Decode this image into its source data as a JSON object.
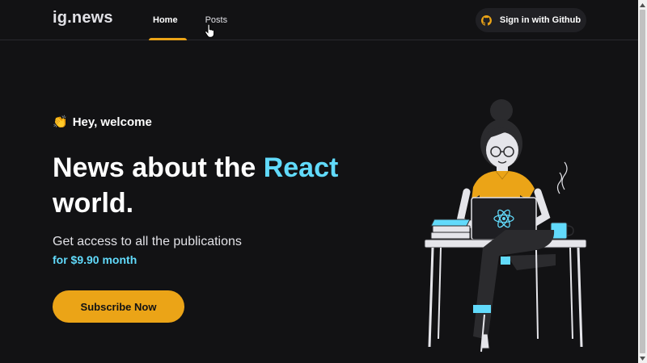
{
  "header": {
    "logo": "ig.news",
    "nav": [
      {
        "label": "Home",
        "active": true
      },
      {
        "label": "Posts",
        "active": false
      }
    ],
    "signin_label": "Sign in with Github"
  },
  "hero": {
    "greeting_icon": "clapping-hands-icon",
    "greeting": "Hey, welcome",
    "headline_part1": "News about the ",
    "headline_accent": "React",
    "headline_part2": "world.",
    "subtext": "Get access to all the publications",
    "price": "for $9.90 month",
    "cta_label": "Subscribe Now"
  },
  "colors": {
    "background": "#121214",
    "accent_yellow": "#eba417",
    "accent_cyan": "#61dafb",
    "text": "#e1e1e6"
  }
}
